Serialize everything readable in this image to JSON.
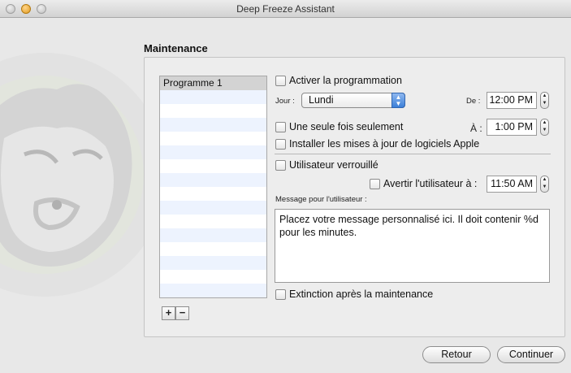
{
  "window": {
    "title": "Deep Freeze Assistant"
  },
  "section": {
    "title": "Maintenance"
  },
  "schedule_list": {
    "items": [
      "Programme 1",
      "",
      "",
      "",
      "",
      "",
      "",
      "",
      "",
      "",
      "",
      "",
      "",
      "",
      "",
      ""
    ],
    "add_label": "+",
    "remove_label": "−"
  },
  "options": {
    "enable_schedule": "Activer la programmation",
    "day_label": "Jour :",
    "day_value": "Lundi",
    "from_label": "De :",
    "from_time": "12:00 PM",
    "once_only": "Une seule fois seulement",
    "to_label": "À :",
    "to_time": "1:00 PM",
    "install_updates": "Installer les mises à jour de logiciels Apple",
    "user_locked": "Utilisateur verrouillé",
    "warn_user": "Avertir l'utilisateur à :",
    "warn_time": "11:50 AM",
    "message_label": "Message pour l'utilisateur :",
    "message_value": "Placez  votre message personnalisé ici. Il doit contenir %d pour les minutes.",
    "shutdown_after": "Extinction après la maintenance"
  },
  "buttons": {
    "back": "Retour",
    "continue": "Continuer"
  }
}
